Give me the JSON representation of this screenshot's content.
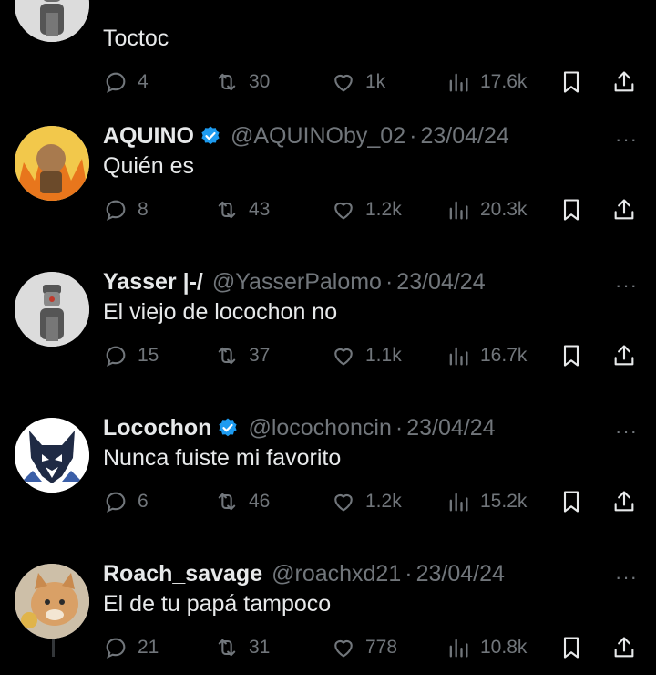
{
  "tweets": [
    {
      "name": "",
      "handle": "",
      "date": "",
      "verified": false,
      "text": "Toctoc",
      "replies": "4",
      "retweets": "30",
      "likes": "1k",
      "views": "17.6k",
      "avatar": "gray-character-avatar"
    },
    {
      "name": "AQUINO",
      "handle": "@AQUINOby_02",
      "date": "23/04/24",
      "verified": true,
      "text": "Quién es",
      "replies": "8",
      "retweets": "43",
      "likes": "1.2k",
      "views": "20.3k",
      "avatar": "fire-character-avatar"
    },
    {
      "name": "Yasser |-/",
      "handle": "@YasserPalomo",
      "date": "23/04/24",
      "verified": false,
      "text": "El viejo de locochon no",
      "replies": "15",
      "retweets": "37",
      "likes": "1.1k",
      "views": "16.7k",
      "avatar": "gray-character-avatar"
    },
    {
      "name": "Locochon",
      "handle": "@locochoncin",
      "date": "23/04/24",
      "verified": true,
      "text": "Nunca fuiste mi favorito",
      "replies": "6",
      "retweets": "46",
      "likes": "1.2k",
      "views": "15.2k",
      "avatar": "wolf-logo-avatar"
    },
    {
      "name": "Roach_savage",
      "handle": "@roachxd21",
      "date": "23/04/24",
      "verified": false,
      "text": "El de tu papá tampoco",
      "replies": "21",
      "retweets": "31",
      "likes": "778",
      "views": "10.8k",
      "avatar": "cat-photo-avatar"
    }
  ],
  "separator": "·",
  "more_glyph": "···",
  "colors": {
    "background": "#000000",
    "text": "#e7e9ea",
    "muted": "#71767b",
    "verified": "#1d9bf0"
  }
}
